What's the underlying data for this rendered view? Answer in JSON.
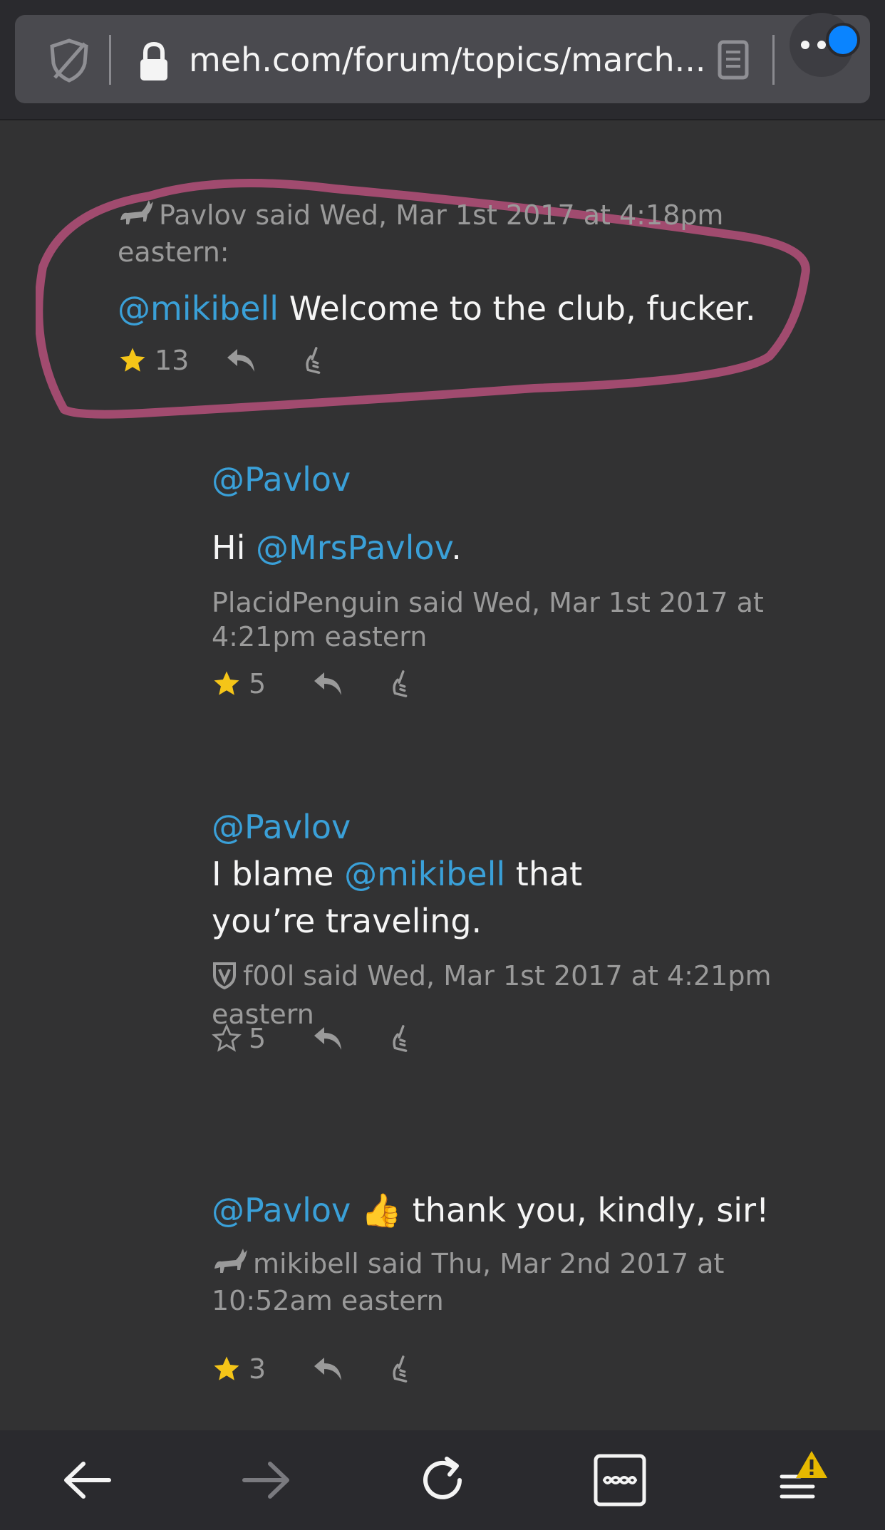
{
  "browser": {
    "url": "meh.com/forum/topics/march...",
    "notification_color": "#0a84ff",
    "warning_color": "#e6b800"
  },
  "posts": [
    {
      "author_line": "Pavlov said Wed, Mar 1st 2017 at 4:18pm eastern:",
      "mention": "@mikibell",
      "text": " Welcome to the club, fucker.",
      "stars": "13"
    },
    {
      "mention_line": "@Pavlov",
      "text_prefix": "Hi ",
      "mention": "@MrsPavlov",
      "text_suffix": ".",
      "author_line": "PlacidPenguin said Wed, Mar 1st 2017 at 4:21pm eastern",
      "stars": "5"
    },
    {
      "mention_line": "@Pavlov",
      "text_prefix": "I blame ",
      "mention": "@mikibell",
      "text_suffix": " that you’re traveling.",
      "author_line": "f00l said Wed, Mar 1st 2017 at 4:21pm eastern",
      "stars": "5"
    },
    {
      "mention": "@Pavlov",
      "emoji": "👍",
      "text": " thank you, kindly, sir!",
      "author_line": "mikibell said Thu, Mar 2nd 2017 at 10:52am eastern",
      "stars": "3"
    }
  ],
  "colors": {
    "mention": "#3aa0d8",
    "star_filled": "#f5c518",
    "highlight_circle": "#b5507a"
  }
}
